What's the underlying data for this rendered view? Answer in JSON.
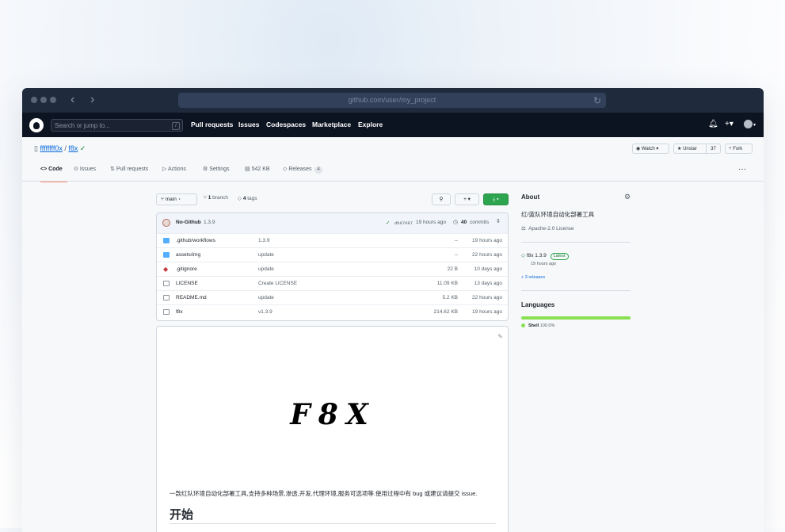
{
  "browser": {
    "url": "github.com/user/my_project"
  },
  "header": {
    "search_placeholder": "Search or jump to...",
    "search_key": "/",
    "nav": [
      "Pull requests",
      "Issues",
      "Codespaces",
      "Marketplace",
      "Explore"
    ]
  },
  "repo": {
    "owner": "ffffffff0x",
    "separator": "/",
    "name": "f8x",
    "watch_label": "Watch",
    "unstar_label": "Unstar",
    "star_count": "37",
    "fork_label": "Fork"
  },
  "tabs": [
    {
      "icon": "code-icon",
      "glyph": "<>",
      "label": "Code",
      "active": true
    },
    {
      "icon": "issues-icon",
      "glyph": "⊙",
      "label": "Issues"
    },
    {
      "icon": "pull-request-icon",
      "glyph": "⇅",
      "label": "Pull requests"
    },
    {
      "icon": "actions-icon",
      "glyph": "▷",
      "label": "Actions"
    },
    {
      "icon": "settings-icon",
      "glyph": "⚙",
      "label": "Settings"
    },
    {
      "icon": "storage-icon",
      "glyph": "▤",
      "label": "542 KB"
    },
    {
      "icon": "tag-icon",
      "glyph": "◇",
      "label": "Releases",
      "counter": "4"
    }
  ],
  "toolbar": {
    "branch_label": "main",
    "branch_count": "1",
    "branch_word": "branch",
    "tag_count": "4",
    "tag_word": "tags",
    "add_label": "+",
    "code_label": "⤓"
  },
  "commit": {
    "author": "No-Github",
    "message": "1.3.9",
    "hash": "db67087",
    "time": "19 hours ago",
    "count": "40",
    "count_word": "commits"
  },
  "files": [
    {
      "type": "folder",
      "name": ".github/workflows",
      "message": "1.3.9",
      "size": "--",
      "date": "19 hours ago"
    },
    {
      "type": "folder",
      "name": "assets/img",
      "message": "update",
      "size": "--",
      "date": "22 hours ago"
    },
    {
      "type": "gitignore",
      "name": ".gitignore",
      "message": "update",
      "size": "22 B",
      "date": "10 days ago"
    },
    {
      "type": "file",
      "name": "LICENSE",
      "message": "Create LICENSE",
      "size": "11.09 KB",
      "date": "13 days ago"
    },
    {
      "type": "file",
      "name": "README.md",
      "message": "update",
      "size": "5.2 KB",
      "date": "22 hours ago"
    },
    {
      "type": "file",
      "name": "f8x",
      "message": "v1.3.9",
      "size": "214.62 KB",
      "date": "19 hours ago"
    }
  ],
  "readme": {
    "logo": "F8X",
    "description": "一款红队环境自动化部署工具,支持多种场景,渗透,开发,代理环境,服务可选项等.使用过程中有 bug 或建议请提交 issue.",
    "heading": "开始"
  },
  "sidebar": {
    "about_title": "About",
    "description": "红/蓝队环境自动化部署工具",
    "license": "Apache-2.0 License",
    "release_tag": "f8x 1.3.9",
    "release_badge": "Latest",
    "release_date": "19 hours ago",
    "more_releases": "+ 3 releases",
    "languages_title": "Languages",
    "language": {
      "name": "Shell",
      "percent": "100.0%",
      "share": 1.0,
      "color": "#89e051"
    }
  }
}
